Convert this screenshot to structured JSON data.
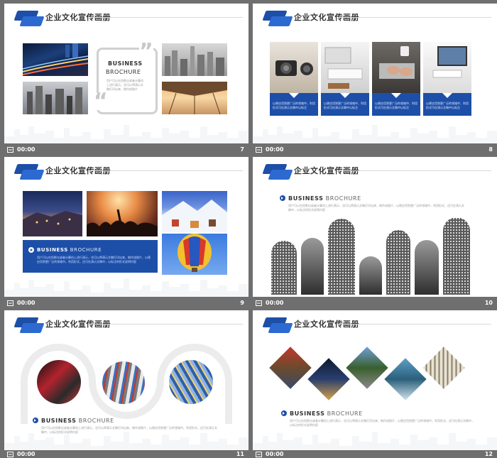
{
  "slide_title": "企业文化宣传画册",
  "time": "00:00",
  "brochure": {
    "bold": "BUSINESS",
    "light": "BROCHURE"
  },
  "quote": {
    "line1": "BUSINESS",
    "line2": "BROCHURE",
    "text": "用户可以在投影仪或者计算机上进行演示，也可以将演示文稿打印出来，制作成胶片"
  },
  "slides": [
    {
      "number": "7"
    },
    {
      "number": "8"
    },
    {
      "number": "9"
    },
    {
      "number": "10"
    },
    {
      "number": "11"
    },
    {
      "number": "12"
    }
  ],
  "body_text": {
    "long": "用户可以在投影仪或者计算机上进行演示，也可以将演示文稿打印出来，制作成胶片，以便应用到更广泛的领域中。利用形式，还可在演示文稿中，以标注的形式说明内容",
    "short": "以便应用到更广泛的领域中，利用形式还可在演示文稿中以标注",
    "caption": "以便应用到更广泛的领域中，利用形式可在演示文稿中以标注"
  },
  "colors": {
    "accent": "#1d4fa8",
    "accent_light": "#2c6ad1",
    "background": "#6f6f6f"
  }
}
